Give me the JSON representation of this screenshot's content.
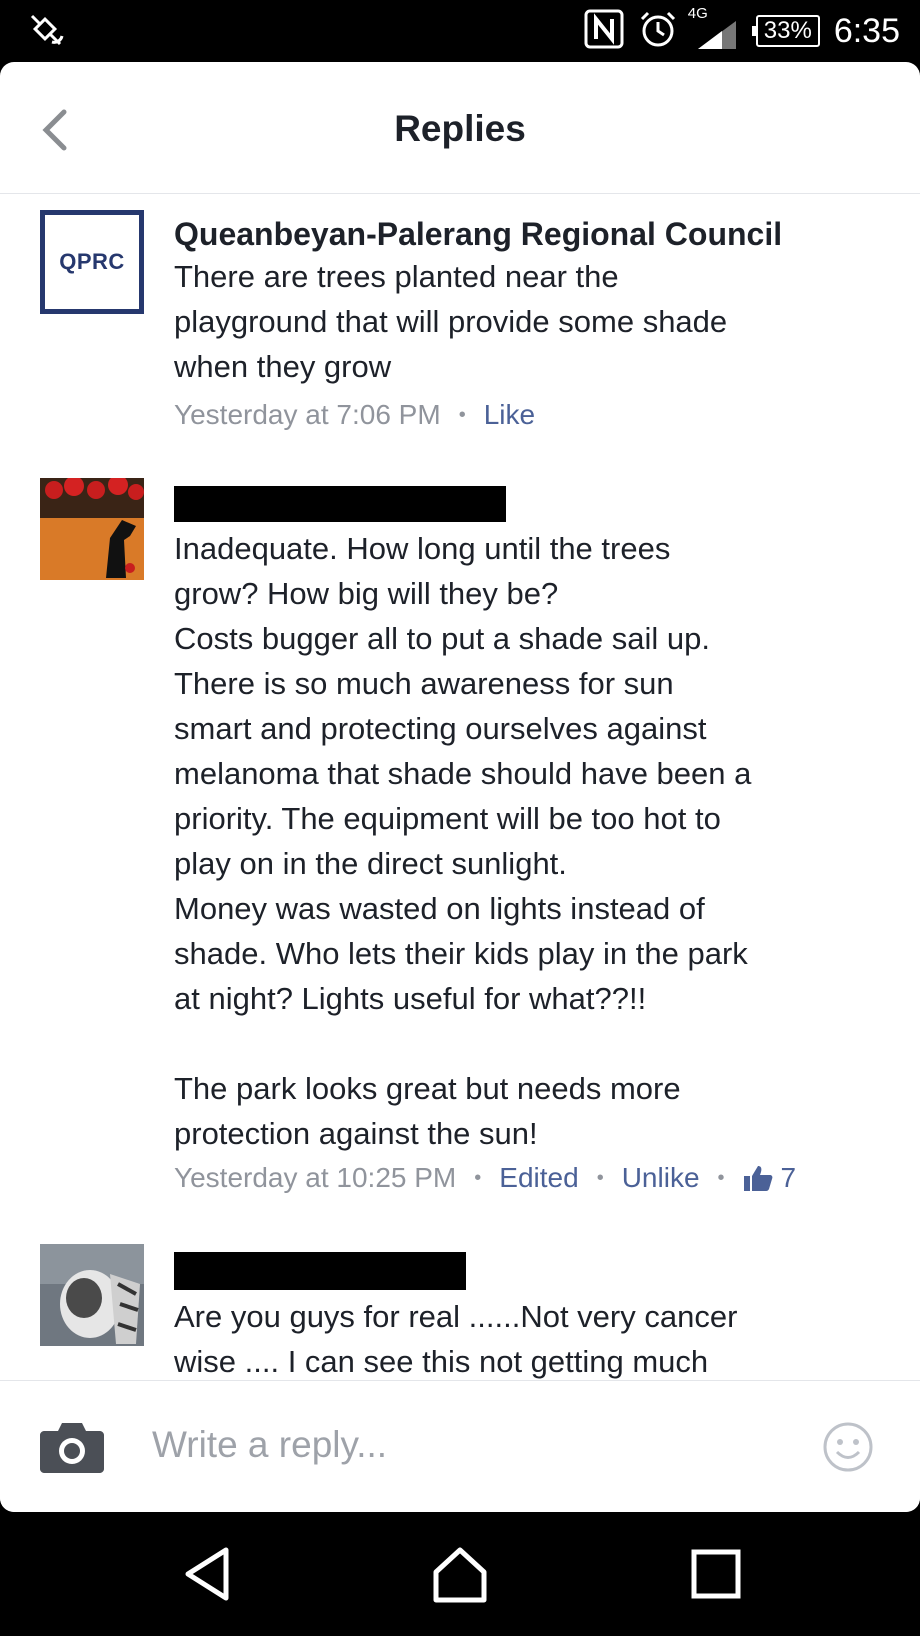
{
  "status_bar": {
    "time": "6:35",
    "battery": "33%",
    "network": "4G"
  },
  "header": {
    "title": "Replies"
  },
  "comments": [
    {
      "avatar_text": "QPRC",
      "author": "Queanbeyan-Palerang Regional Council",
      "text": "There are trees planted near the\nplayground that will provide some shade\nwhen they grow",
      "timestamp": "Yesterday at 7:06 PM",
      "like_label": "Like"
    },
    {
      "author": "",
      "text": "Inadequate. How long until the trees\ngrow? How big will they be?\nCosts bugger all to put a shade sail up.\nThere is so much awareness for sun\nsmart and protecting ourselves against\nmelanoma that shade should have been a\npriority. The equipment will be too hot to\nplay on in the direct sunlight.\nMoney was wasted on lights instead of\nshade. Who lets their kids play in the park\nat night? Lights useful for what??!!\n\nThe park looks great but needs more\nprotection against the sun!",
      "timestamp": "Yesterday at 10:25 PM",
      "edited_label": "Edited",
      "unlike_label": "Unlike",
      "like_count": "7"
    },
    {
      "author": "",
      "text": "Are you guys for real ......Not very cancer\nwise .... I can see this not getting much"
    }
  ],
  "reply_bar": {
    "placeholder": "Write a reply..."
  },
  "icons": {
    "accent": "#4b6197",
    "brand": "#26386e"
  }
}
